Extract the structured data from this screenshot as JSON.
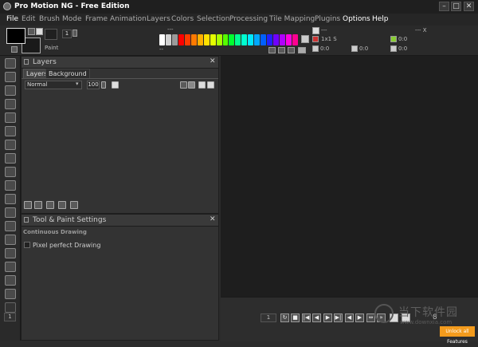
{
  "window": {
    "title": "Pro Motion NG - Free Edition",
    "minimize_label": "–",
    "maximize_label": "□",
    "close_label": "✕"
  },
  "menu": [
    "File",
    "Edit",
    "Brush",
    "Mode",
    "Frame",
    "Animation",
    "Layers",
    "Colors",
    "Selection",
    "Processing",
    "Tile Mapping",
    "Plugins",
    "Options",
    "Help"
  ],
  "toolbar": {
    "brush_size": "1",
    "paint_label": "Paint",
    "fg_color": "#000000",
    "bg_color": "#1a1a1a",
    "palette_top_label": "---",
    "palette_bottom_label": "--",
    "palette_colors": [
      "#ffffff",
      "#d0d0d0",
      "#9a9a9a",
      "#ff0000",
      "#ff3b00",
      "#ff7a00",
      "#ffb000",
      "#ffe000",
      "#e4ff00",
      "#a8ff00",
      "#55ff00",
      "#00ff30",
      "#00ff90",
      "#00ffd0",
      "#00e8ff",
      "#00a8ff",
      "#0060ff",
      "#2020ff",
      "#7000ff",
      "#b000ff",
      "#ff00e0",
      "#ff0090"
    ],
    "tile_label": "---",
    "tile_xy": "--- X",
    "zoom_ratio": "1x1 S",
    "coord_a": "0:0",
    "coord_b": "0:0",
    "coord_c": "0:0",
    "coord_d": "0:0",
    "coord_e": "0:0"
  },
  "layers_panel": {
    "title": "Layers",
    "tabs": [
      "Layers",
      "Background"
    ],
    "blend_mode": "Normal",
    "opacity": "100"
  },
  "tool_panel": {
    "title": "Tool & Paint Settings",
    "section": "Continuous Drawing",
    "checkbox_label": "Pixel perfect Drawing"
  },
  "bottom": {
    "frame_number": "1",
    "leftbar_frame": "1",
    "frame_count": "8",
    "unlock_label": "Unlock all Features"
  },
  "watermark": {
    "text": "当下软件园",
    "url": "www.downxia.com"
  }
}
